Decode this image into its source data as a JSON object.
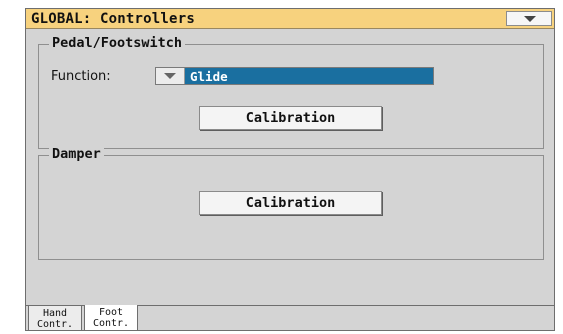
{
  "window": {
    "title": "GLOBAL: Controllers"
  },
  "pedal": {
    "title": "Pedal/Footswitch",
    "function_label": "Function:",
    "function_value": "Glide",
    "calibration_label": "Calibration"
  },
  "damper": {
    "title": "Damper",
    "calibration_label": "Calibration"
  },
  "tabs": [
    {
      "line1": "Hand",
      "line2": "Contr."
    },
    {
      "line1": "Foot",
      "line2": "Contr."
    }
  ],
  "colors": {
    "title_bg": "#f7d27e",
    "select_bg": "#1a6fa0",
    "panel_bg": "#d4d4d4"
  },
  "icons": {
    "menu": "chevron-down-icon",
    "select": "chevron-down-icon"
  }
}
